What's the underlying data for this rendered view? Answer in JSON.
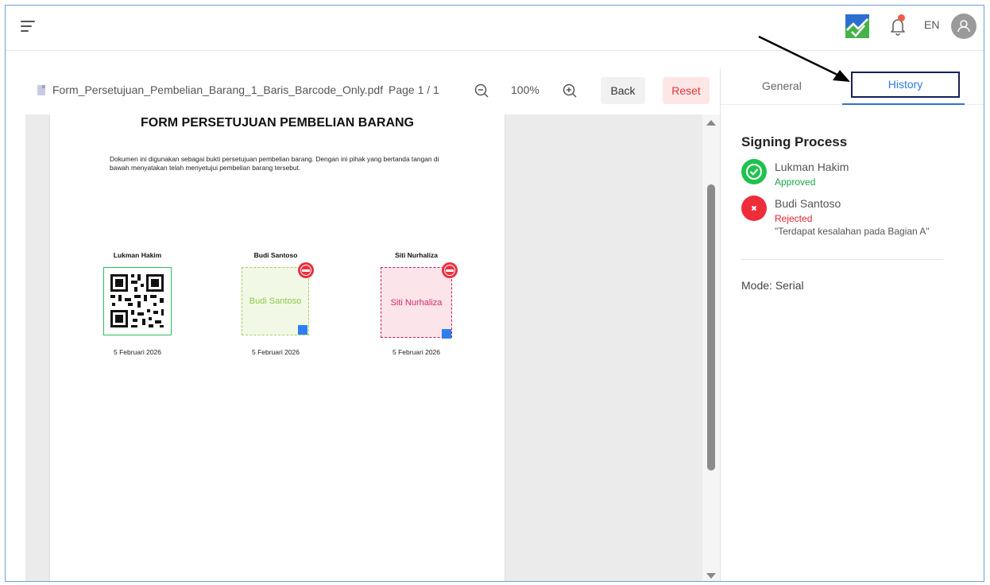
{
  "header": {
    "language": "EN",
    "colors": {
      "notification_dot": "#f05a4a"
    }
  },
  "toolbar": {
    "file_name": "Form_Persetujuan_Pembelian_Barang_1_Baris_Barcode_Only.pdf",
    "page_info": "Page 1 / 1",
    "zoom_level": "100%",
    "back_label": "Back",
    "reset_label": "Reset"
  },
  "document": {
    "title": "FORM PERSETUJUAN PEMBELIAN BARANG",
    "description": "Dokumen ini digunakan sebagai bukti persetujuan pembelian barang. Dengan ini pihak yang bertanda tangan di bawah menyatakan telah menyetujui pembelian barang tersebut.",
    "signers": [
      {
        "name": "Lukman Hakim",
        "date": "5 Februari 2026",
        "type": "qr-code"
      },
      {
        "name": "Budi Santoso",
        "date": "5 Februari 2026",
        "placeholder": "Budi Santoso"
      },
      {
        "name": "Siti Nurhaliza",
        "date": "5 Februari 2026",
        "placeholder": "Siti Nurhaliza"
      }
    ]
  },
  "panel": {
    "tabs": {
      "general": "General",
      "history": "History",
      "active": "History"
    },
    "section_title": "Signing Process",
    "steps": [
      {
        "name": "Lukman Hakim",
        "status": "Approved",
        "status_color": "#1aa84a",
        "icon": "check-circle-icon"
      },
      {
        "name": "Budi Santoso",
        "status": "Rejected",
        "status_color": "#e3222f",
        "icon": "x-circle-icon",
        "note": "\"Terdapat kesalahan pada Bagian A\""
      }
    ],
    "mode": "Mode: Serial"
  }
}
